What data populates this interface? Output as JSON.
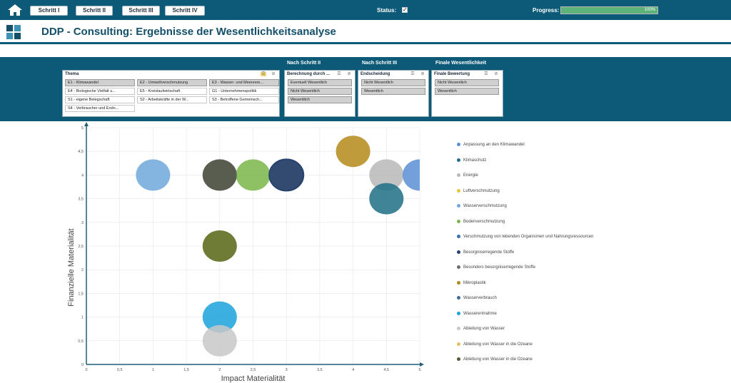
{
  "topbar": {
    "buttons": [
      "Schritt I",
      "Schritt II",
      "Schritt III",
      "Schritt IV"
    ],
    "status_label": "Status:",
    "status_check": "✓",
    "progress_label": "Progress:",
    "progress_value": 100,
    "progress_text": "100%"
  },
  "title": "DDP - Consulting: Ergebnisse der Wesentlichkeitsanalyse",
  "filters": {
    "thema": {
      "label": "Thema",
      "items": [
        {
          "text": "E1 - Klimawandel",
          "selected": true
        },
        {
          "text": "E2 - Umweltverschmutzung",
          "selected": true
        },
        {
          "text": "E3 - Wasser- und Meeresre...",
          "selected": true
        },
        {
          "text": "E4 - Biologische Vielfalt u...",
          "selected": false
        },
        {
          "text": "E5 - Kreislaufwirtschaft",
          "selected": false
        },
        {
          "text": "G1 - Unternehmenspolitik",
          "selected": false
        },
        {
          "text": "S1 - eigene Belegschaft",
          "selected": false
        },
        {
          "text": "S2 - Arbeitskräfte in der W...",
          "selected": false
        },
        {
          "text": "S3 - Betroffene Gemeinsch...",
          "selected": false
        },
        {
          "text": "S4 - Verbraucher und Endn...",
          "selected": false
        }
      ]
    },
    "schritt2": {
      "heading": "Nach Schritt II",
      "label": "Berechnung durch ...",
      "items": [
        "Eventuell Wesentlich",
        "Nicht Wesentlich",
        "Wesentlich"
      ]
    },
    "schritt3": {
      "heading": "Nach Schritt III",
      "label": "Endscheidung",
      "items": [
        "Nicht Wesentlich",
        "Wesentlich"
      ]
    },
    "finale": {
      "heading": "Finale Wesentlichkeit",
      "label": "Finale Bewertung",
      "items": [
        "Nicht Wesentlich",
        "Wesentlich"
      ]
    }
  },
  "chart_data": {
    "type": "scatter",
    "xlabel": "Impact Materialität",
    "ylabel": "Finanzielle Materialität",
    "xlim": [
      0,
      5
    ],
    "ylim": [
      0,
      5
    ],
    "xticks": [
      "0",
      "0,5",
      "1",
      "1,5",
      "2",
      "2,5",
      "3",
      "3,5",
      "4",
      "4,5",
      "5"
    ],
    "yticks": [
      "0",
      "0,5",
      "1",
      "1,5",
      "2",
      "2,5",
      "3",
      "3,5",
      "4",
      "4,5",
      "5"
    ],
    "grid": true,
    "legend_position": "right",
    "series": [
      {
        "name": "Anpassung an den Klimawandel",
        "color": "#5b8fd4",
        "x": 5,
        "y": 4
      },
      {
        "name": "Klimaschutz",
        "color": "#1f6e85",
        "x": 4.5,
        "y": 3.5
      },
      {
        "name": "Energie",
        "color": "#b8b8b8",
        "x": 4.5,
        "y": 4
      },
      {
        "name": "Luftverschmutzung",
        "color": "#e8c53a",
        "x": null,
        "y": null
      },
      {
        "name": "Wasserverschmutzung",
        "color": "#6ea8dc",
        "x": 1,
        "y": 4
      },
      {
        "name": "Bodenverschmutzung",
        "color": "#7ab648",
        "x": 2.5,
        "y": 4
      },
      {
        "name": "Verschmutzung von lebenden Organismen und Nahrungsressourcen",
        "color": "#3a6fb3",
        "x": null,
        "y": null
      },
      {
        "name": "Besorgniserregende Stoffe",
        "color": "#26426e",
        "x": 3,
        "y": 4
      },
      {
        "name": "Besonders besorgniserregende Stoffe",
        "color": "#6d6d6d",
        "x": 3,
        "y": 4
      },
      {
        "name": "Mikroplastik",
        "color": "#b58a1a",
        "x": 4,
        "y": 4.5
      },
      {
        "name": "Wasserverbrauch",
        "color": "#3f6b9a",
        "x": null,
        "y": null
      },
      {
        "name": "Wasserentnahme",
        "color": "#1aa3dc",
        "x": 2,
        "y": 1
      },
      {
        "name": "Ableitung von Wasser",
        "color": "#c8c8c8",
        "x": 2,
        "y": 0.5
      },
      {
        "name": "Ableitung von Wasser in die Ozeane",
        "color": "#e0c060",
        "x": null,
        "y": null
      },
      {
        "name": "Ableitung von Wasser in die Ozeane",
        "color": "#4f5a3a",
        "x": 2,
        "y": 4
      }
    ],
    "extra_points": [
      {
        "color": "#5e6e20",
        "x": 2,
        "y": 2.5
      }
    ]
  }
}
